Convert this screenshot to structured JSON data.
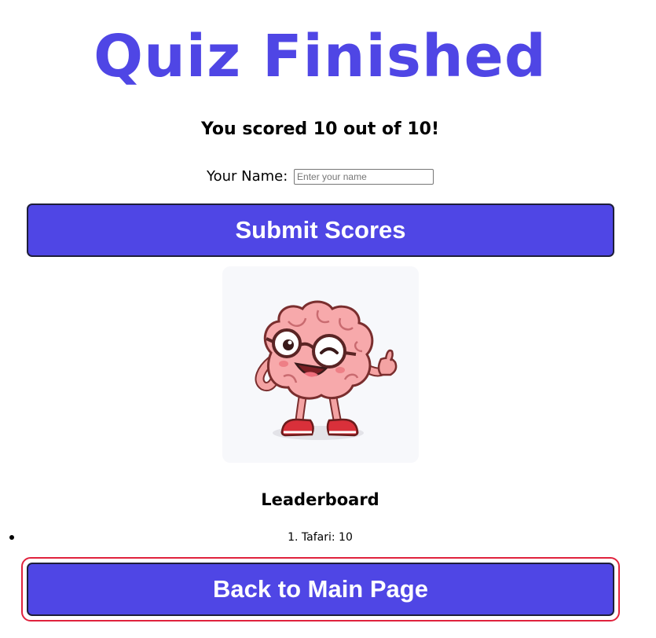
{
  "title": "Quiz Finished",
  "score_text": "You scored 10 out of 10!",
  "name_form": {
    "label": "Your Name:",
    "placeholder": "Enter your name",
    "value": ""
  },
  "submit_button": "Submit Scores",
  "mascot": {
    "icon": "brain-mascot-thumbs-up"
  },
  "leaderboard": {
    "heading": "Leaderboard",
    "entries": [
      "1. Tafari: 10"
    ]
  },
  "back_button": "Back to Main Page",
  "colors": {
    "accent": "#4f46e5",
    "focus_ring": "#e0223d",
    "card_background": "#f7f8fb"
  }
}
